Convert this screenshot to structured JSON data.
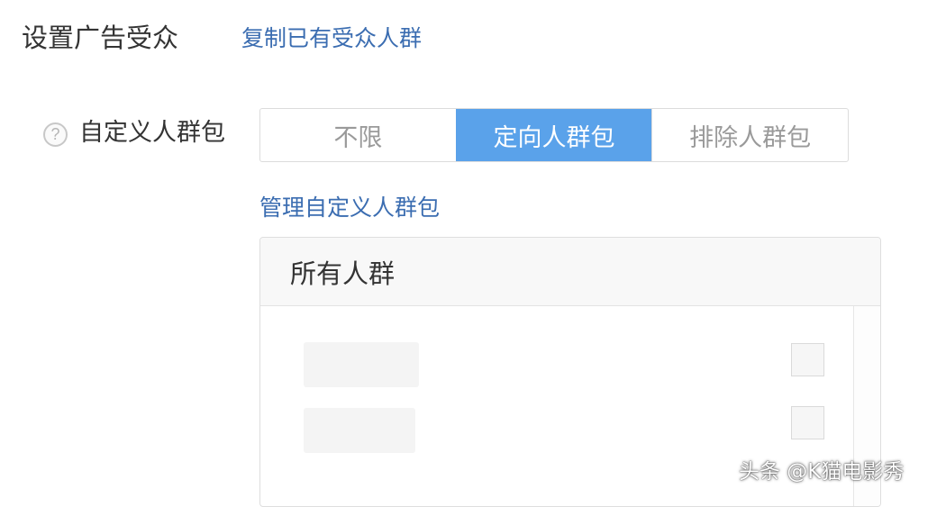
{
  "section": {
    "title": "设置广告受众",
    "copy_link": "复制已有受众人群"
  },
  "field": {
    "help_symbol": "?",
    "label": "自定义人群包",
    "options": [
      "不限",
      "定向人群包",
      "排除人群包"
    ],
    "selected_index": 1
  },
  "manage_link": "管理自定义人群包",
  "panel": {
    "header": "所有人群"
  },
  "watermark": "头条 @K猫电影秀",
  "colors": {
    "accent": "#5aa2ea",
    "link": "#3b6db1",
    "text": "#333333",
    "muted": "#9a9a9a"
  }
}
